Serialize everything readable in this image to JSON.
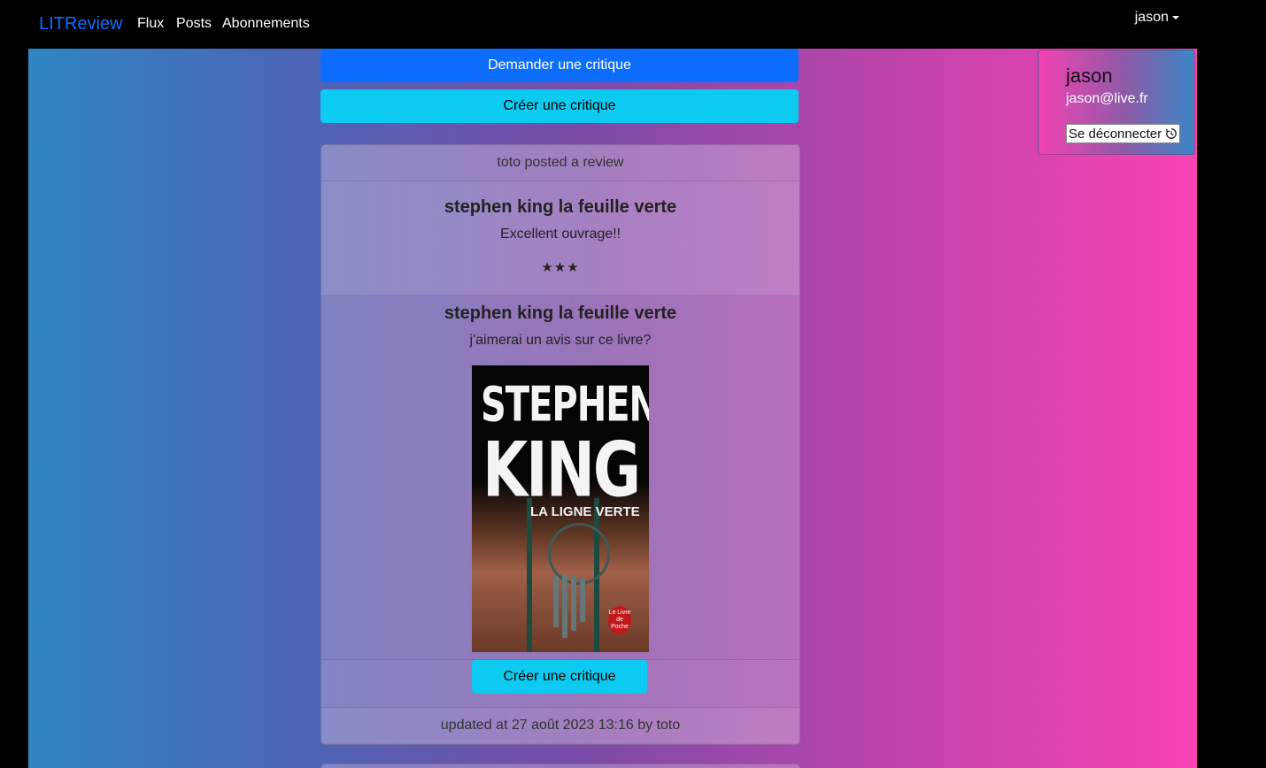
{
  "nav": {
    "brand": "LITReview",
    "links": [
      "Flux",
      "Posts",
      "Abonnements"
    ],
    "user": "jason"
  },
  "actions": {
    "ask_review": "Demander une critique",
    "create_review": "Créer une critique"
  },
  "post": {
    "header": "toto posted a review",
    "review": {
      "title": "stephen king la feuille verte",
      "body": "Excellent ouvrage!!",
      "rating_stars": "★★★",
      "rating": 3
    },
    "ticket": {
      "title": "stephen king la feuille verte",
      "body": "j'aimerai un avis sur ce livre?",
      "cover": {
        "author_line1": "STEPHEN",
        "author_line2": "KING",
        "book_title": "LA LIGNE VERTE",
        "publisher_seal": "Le Livre de Poche"
      },
      "create_button": "Créer une critique"
    },
    "footer": "updated at 27 août 2023 13:16 by toto"
  },
  "profile": {
    "name": "jason",
    "email": "jason@live.fr",
    "logout": "Se déconnecter"
  },
  "colors": {
    "primary": "#0d6efd",
    "info": "#0dcaf0",
    "gradient_left": "#2f86c3",
    "gradient_right": "#f843b3"
  }
}
